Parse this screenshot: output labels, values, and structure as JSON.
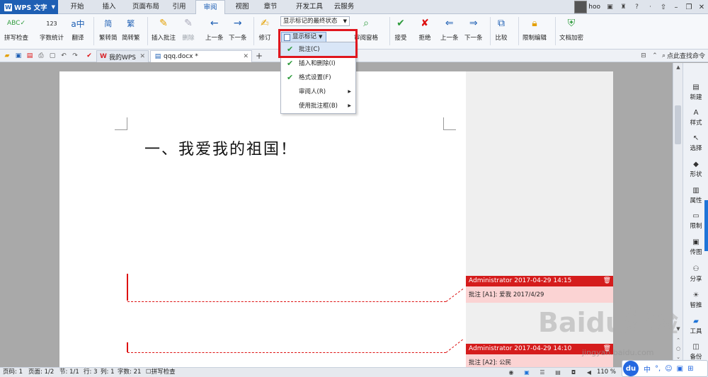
{
  "app": {
    "name": "WPS 文字",
    "logo_letter": "W"
  },
  "menu_tabs": [
    {
      "label": "开始"
    },
    {
      "label": "插入"
    },
    {
      "label": "页面布局"
    },
    {
      "label": "引用"
    },
    {
      "label": "审阅"
    },
    {
      "label": "视图"
    },
    {
      "label": "章节"
    },
    {
      "label": "开发工具"
    },
    {
      "label": "云服务"
    }
  ],
  "active_tab": "审阅",
  "user": {
    "name": "hoo"
  },
  "ribbon": {
    "spell_check": "拼写检查",
    "word_count": "字数统计",
    "translate": "翻译",
    "trad_to_simp": "繁转简",
    "simp_to_trad": "简转繁",
    "insert_comment": "插入批注",
    "delete": "删除",
    "prev_comment": "上一条",
    "next_comment": "下一条",
    "revise": "修订",
    "display_state": "显示标记的最终状态",
    "show_markup": "显示标记",
    "review_pane": "审阅窗格",
    "accept": "接受",
    "reject": "拒绝",
    "prev_change": "上一条",
    "next_change": "下一条",
    "compare": "比较",
    "restrict_edit": "限制编辑",
    "doc_encrypt": "文档加密"
  },
  "markup_menu": [
    {
      "label": "批注(C)",
      "checked": true,
      "submenu": false
    },
    {
      "label": "插入和删除(I)",
      "checked": true,
      "submenu": false
    },
    {
      "label": "格式设置(F)",
      "checked": true,
      "submenu": false
    },
    {
      "label": "审阅人(R)",
      "checked": false,
      "submenu": true
    },
    {
      "label": "使用批注框(B)",
      "checked": false,
      "submenu": true
    }
  ],
  "doc_tabs": [
    {
      "label": "我的WPS"
    },
    {
      "label": "qqq.docx *"
    }
  ],
  "search_command": "点此查找命令",
  "document": {
    "heading": "一、我爱我的祖国！"
  },
  "comments": [
    {
      "header": "Administrator 2017-04-29 14:15",
      "body": "批注 [A1]: 爱我 2017/4/29"
    },
    {
      "header": "Administrator 2017-04-29 14:10",
      "body": "批注 [A2]: 公民"
    }
  ],
  "sidebar": [
    {
      "label": "新建"
    },
    {
      "label": "样式"
    },
    {
      "label": "选择"
    },
    {
      "label": "形状"
    },
    {
      "label": "属性"
    },
    {
      "label": "限制"
    },
    {
      "label": "传图"
    },
    {
      "label": "分享"
    },
    {
      "label": "智推"
    },
    {
      "label": "工具"
    },
    {
      "label": "备份"
    }
  ],
  "status": {
    "page": "页码: 1",
    "pages": "页面: 1/2",
    "section": "节: 1/1",
    "row": "行: 3",
    "col": "列: 1",
    "chars": "字数: 21",
    "spell": "拼写检查",
    "zoom": "110 %"
  },
  "ime": {
    "logo": "du",
    "lang": "中"
  },
  "watermark": {
    "brand": "Baidu经验",
    "url": "jingyan.baidu.com"
  },
  "colors": {
    "accent": "#1e5fb4",
    "comment_red": "#d51c1c",
    "highlight_box": "#e0161e"
  }
}
